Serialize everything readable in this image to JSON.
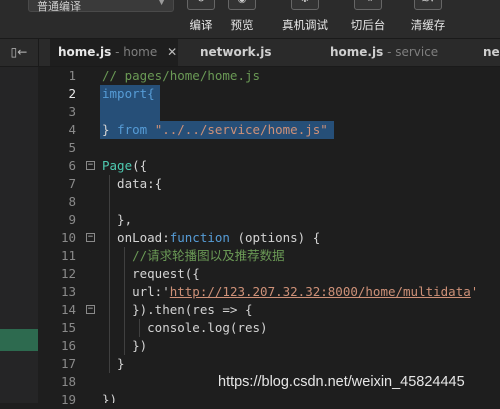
{
  "toolbar": {
    "mode_select_value": "普通编译",
    "buttons": [
      {
        "label": "编译",
        "icon": "refresh-icon"
      },
      {
        "label": "预览",
        "icon": "eye-icon"
      },
      {
        "label": "真机调试",
        "icon": "debug-icon"
      },
      {
        "label": "切后台",
        "icon": "switch-background-icon"
      },
      {
        "label": "清缓存",
        "icon": "layers-icon"
      }
    ]
  },
  "tabs": [
    {
      "name": "home.js",
      "context": " - home",
      "active": true
    },
    {
      "name": "network.js",
      "context": "",
      "active": false
    },
    {
      "name": "home.js",
      "context": " - service",
      "active": false
    },
    {
      "name": "ne",
      "context": "",
      "active": false
    }
  ],
  "line_numbers": [
    "1",
    "2",
    "3",
    "4",
    "5",
    "6",
    "7",
    "8",
    "9",
    "10",
    "11",
    "12",
    "13",
    "14",
    "15",
    "16",
    "17",
    "18",
    "19"
  ],
  "current_line": "2",
  "code": {
    "l1": "// pages/home/home.js",
    "l2": "import{",
    "l4a": "} ",
    "l4b": "from",
    "l4c": " ",
    "l4d": "\"../../service/home.js\"",
    "l6a": "Page",
    "l6b": "({",
    "l7": "  data:{",
    "l9": "  },",
    "l10a": "  onLoad:",
    "l10b": "function",
    "l10c": " (options) {",
    "l11": "    //请求轮播图以及推荐数据",
    "l12": "    request({",
    "l13a": "    url:'",
    "l13b": "http://123.207.32.32:8000/home/multidata",
    "l13c": "'",
    "l14": "    }).then(res => {",
    "l15": "      console.log(res)",
    "l16": "    })",
    "l17": "  }",
    "l19": "})"
  },
  "watermark": "https://blog.csdn.net/weixin_45824445"
}
